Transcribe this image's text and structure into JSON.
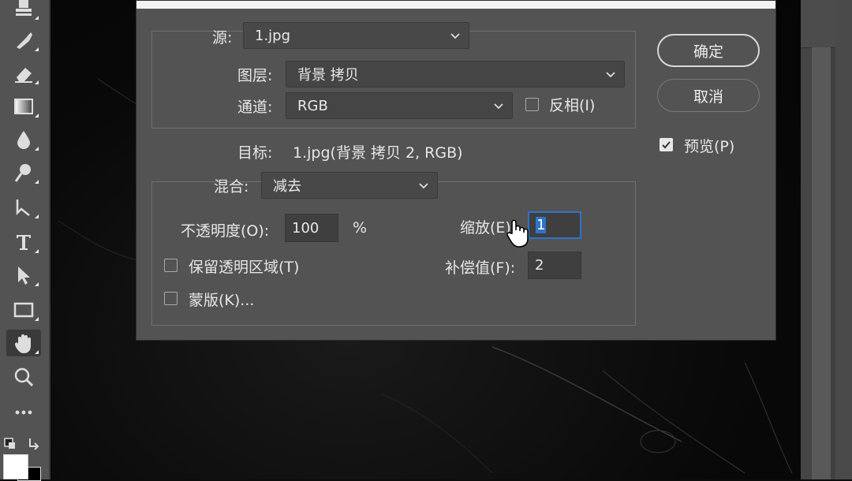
{
  "dialog": {
    "source_label": "源:",
    "source_value": "1.jpg",
    "layer_label": "图层:",
    "layer_value": "背景 拷贝",
    "channel_label": "通道:",
    "channel_value": "RGB",
    "invert_label": "反相(I)",
    "target_label": "目标:",
    "target_value": "1.jpg(背景 拷贝 2, RGB)",
    "blend_label": "混合:",
    "blend_value": "减去",
    "opacity_label": "不透明度(O):",
    "opacity_value": "100",
    "opacity_unit": "%",
    "scale_label": "缩放(E):",
    "scale_value": "1",
    "offset_label": "补偿值(F):",
    "offset_value": "2",
    "preserve_transparency_label": "保留透明区域(T)",
    "mask_label": "蒙版(K)...",
    "ok_label": "确定",
    "cancel_label": "取消",
    "preview_label": "预览(P)",
    "preview_checked": true,
    "invert_checked": false,
    "preserve_checked": false,
    "mask_checked": false
  }
}
